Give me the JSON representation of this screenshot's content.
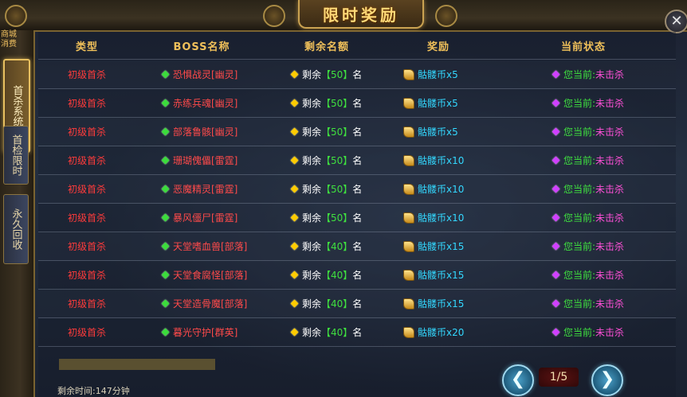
{
  "window": {
    "title": "限时奖励",
    "close_icon": "✕"
  },
  "sidebar": {
    "top_label": "商城 消费",
    "tabs": [
      {
        "label": "首杀系统",
        "active": true
      },
      {
        "label": "首检限时",
        "active": false
      },
      {
        "label": "永久回收",
        "active": false
      }
    ]
  },
  "table": {
    "headers": [
      "类型",
      "BOSS名称",
      "剩余名额",
      "奖励",
      "当前状态"
    ],
    "rows": [
      {
        "type": "初级首杀",
        "boss": "恐惧战灵[幽灵]",
        "remain_prefix": "剩余",
        "remain_num": "【50】",
        "remain_suffix": "名",
        "reward": "骷髅币x5",
        "status_prefix": "您当前:",
        "status_value": "未击杀"
      },
      {
        "type": "初级首杀",
        "boss": "赤练兵魂[幽灵]",
        "remain_prefix": "剩余",
        "remain_num": "【50】",
        "remain_suffix": "名",
        "reward": "骷髅币x5",
        "status_prefix": "您当前:",
        "status_value": "未击杀"
      },
      {
        "type": "初级首杀",
        "boss": "部落鲁骸[幽灵]",
        "remain_prefix": "剩余",
        "remain_num": "【50】",
        "remain_suffix": "名",
        "reward": "骷髅币x5",
        "status_prefix": "您当前:",
        "status_value": "未击杀"
      },
      {
        "type": "初级首杀",
        "boss": "珊瑚傀儡[雷霆]",
        "remain_prefix": "剩余",
        "remain_num": "【50】",
        "remain_suffix": "名",
        "reward": "骷髅币x10",
        "status_prefix": "您当前:",
        "status_value": "未击杀"
      },
      {
        "type": "初级首杀",
        "boss": "恶魔精灵[雷霆]",
        "remain_prefix": "剩余",
        "remain_num": "【50】",
        "remain_suffix": "名",
        "reward": "骷髅币x10",
        "status_prefix": "您当前:",
        "status_value": "未击杀"
      },
      {
        "type": "初级首杀",
        "boss": "暴风僵尸[雷霆]",
        "remain_prefix": "剩余",
        "remain_num": "【50】",
        "remain_suffix": "名",
        "reward": "骷髅币x10",
        "status_prefix": "您当前:",
        "status_value": "未击杀"
      },
      {
        "type": "初级首杀",
        "boss": "天堂嗜血兽[部落]",
        "remain_prefix": "剩余",
        "remain_num": "【40】",
        "remain_suffix": "名",
        "reward": "骷髅币x15",
        "status_prefix": "您当前:",
        "status_value": "未击杀"
      },
      {
        "type": "初级首杀",
        "boss": "天堂食腐怪[部落]",
        "remain_prefix": "剩余",
        "remain_num": "【40】",
        "remain_suffix": "名",
        "reward": "骷髅币x15",
        "status_prefix": "您当前:",
        "status_value": "未击杀"
      },
      {
        "type": "初级首杀",
        "boss": "天堂造骨魔[部落]",
        "remain_prefix": "剩余",
        "remain_num": "【40】",
        "remain_suffix": "名",
        "reward": "骷髅币x15",
        "status_prefix": "您当前:",
        "status_value": "未击杀"
      },
      {
        "type": "初级首杀",
        "boss": "暮光守护[群英]",
        "remain_prefix": "剩余",
        "remain_num": "【40】",
        "remain_suffix": "名",
        "reward": "骷髅币x20",
        "status_prefix": "您当前:",
        "status_value": "未击杀"
      }
    ]
  },
  "footer": {
    "time_remaining": "剩余时间:147分钟",
    "page": "1/5",
    "prev_icon": "❮",
    "next_icon": "❯"
  },
  "colors": {
    "header_gold": "#f0c05a",
    "type_red": "#ff3b3b",
    "remain_green": "#3fe03f",
    "reward_cyan": "#33d8ff",
    "status_magenta": "#ff50d8"
  }
}
